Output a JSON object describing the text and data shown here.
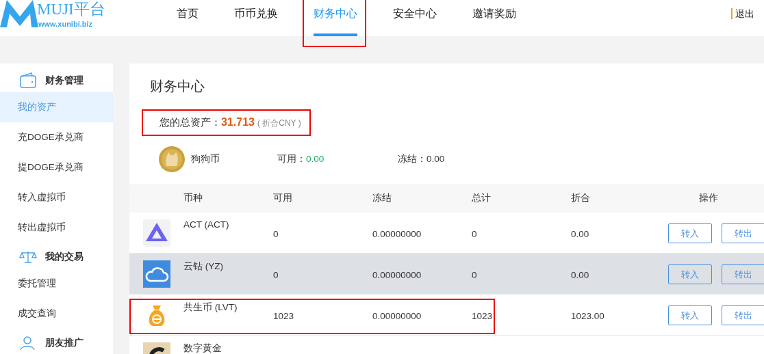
{
  "header": {
    "logo": {
      "title": "MUJI平台",
      "url": "www.xunibi.biz"
    },
    "nav": [
      {
        "label": "首页",
        "selected": false,
        "highlighted": false
      },
      {
        "label": "币币兑换",
        "selected": false,
        "highlighted": false
      },
      {
        "label": "财务中心",
        "selected": true,
        "highlighted": true
      },
      {
        "label": "安全中心",
        "selected": false,
        "highlighted": false
      },
      {
        "label": "邀请奖励",
        "selected": false,
        "highlighted": false
      }
    ],
    "logout": "退出"
  },
  "sidebar": {
    "sections": [
      {
        "title": "财务管理",
        "items": [
          {
            "label": "我的资产",
            "selected": true
          },
          {
            "label": "充DOGE承兑商",
            "selected": false
          },
          {
            "label": "提DOGE承兑商",
            "selected": false
          },
          {
            "label": "转入虚拟币",
            "selected": false
          },
          {
            "label": "转出虚拟币",
            "selected": false
          }
        ]
      },
      {
        "title": "我的交易",
        "items": [
          {
            "label": "委托管理",
            "selected": false
          },
          {
            "label": "成交查询",
            "selected": false
          }
        ]
      },
      {
        "title": "朋友推广"
      }
    ]
  },
  "panel": {
    "title": "财务中心",
    "total": {
      "label": "您的总资产：",
      "value": "31.713",
      "unit": "( 折合CNY )",
      "highlighted": true
    },
    "featured": {
      "name": "狗狗币",
      "available_label": "可用：",
      "available": "0.00",
      "frozen_label": "冻结：",
      "frozen": "0.00"
    },
    "table": {
      "columns": [
        "币种",
        "可用",
        "冻结",
        "总计",
        "折合",
        "操作"
      ],
      "rows": [
        {
          "name": "ACT (ACT)",
          "available": "0",
          "frozen": "0.00000000",
          "total": "0",
          "cny": "0.00",
          "actions": [
            "转入",
            "转出"
          ],
          "selected": false,
          "highlighted": false
        },
        {
          "name": "云钻 (YZ)",
          "available": "0",
          "frozen": "0.00000000",
          "total": "0",
          "cny": "0.00",
          "actions": [
            "转入",
            "转出"
          ],
          "selected": true,
          "highlighted": false
        },
        {
          "name": "共生币 (LVT)",
          "available": "1023",
          "frozen": "0.00000000",
          "total": "1023",
          "cny": "1023.00",
          "actions": [
            "转入",
            "转出"
          ],
          "selected": false,
          "highlighted": true
        },
        {
          "name": "数字黄金",
          "selected": false,
          "highlighted": false
        }
      ]
    }
  }
}
